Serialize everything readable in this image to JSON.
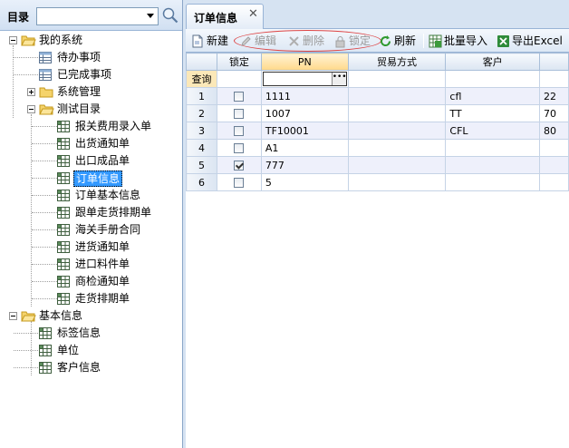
{
  "sidebar": {
    "title": "目录",
    "tree": [
      {
        "label": "我的系统",
        "icon": "folder-open-icon"
      },
      {
        "label": "待办事项",
        "icon": "table-icon"
      },
      {
        "label": "已完成事项",
        "icon": "table-icon"
      },
      {
        "label": "系统管理",
        "icon": "folder-icon"
      },
      {
        "label": "测试目录",
        "icon": "folder-open-icon"
      },
      {
        "label": "报关费用录入单",
        "icon": "form-icon"
      },
      {
        "label": "出货通知单",
        "icon": "form-icon"
      },
      {
        "label": "出口成品单",
        "icon": "form-icon"
      },
      {
        "label": "订单信息",
        "icon": "form-icon",
        "selected": true
      },
      {
        "label": "订单基本信息",
        "icon": "form-icon"
      },
      {
        "label": "跟单走货排期单",
        "icon": "form-icon"
      },
      {
        "label": "海关手册合同",
        "icon": "form-icon"
      },
      {
        "label": "进货通知单",
        "icon": "form-icon"
      },
      {
        "label": "进口料件单",
        "icon": "form-icon"
      },
      {
        "label": "商检通知单",
        "icon": "form-icon"
      },
      {
        "label": "走货排期单",
        "icon": "form-icon"
      },
      {
        "label": "基本信息",
        "icon": "folder-open-icon"
      },
      {
        "label": "标签信息",
        "icon": "form-icon"
      },
      {
        "label": "单位",
        "icon": "form-icon"
      },
      {
        "label": "客户信息",
        "icon": "form-icon"
      }
    ]
  },
  "tab": {
    "title": "订单信息",
    "close": "✕"
  },
  "toolbar": {
    "new": "新建",
    "edit": "编辑",
    "delete": "删除",
    "lock": "锁定",
    "refresh": "刷新",
    "batch_import": "批量导入",
    "export_excel": "导出Excel"
  },
  "grid": {
    "columns": [
      "锁定",
      "PN",
      "贸易方式",
      "客户",
      ""
    ],
    "filter_label": "查询",
    "filter_button": "•••",
    "rows": [
      {
        "num": "1",
        "locked": false,
        "pn": "1111",
        "trade": "",
        "customer": "cfl",
        "extra": "22"
      },
      {
        "num": "2",
        "locked": false,
        "pn": "1007",
        "trade": "",
        "customer": "TT",
        "extra": "70"
      },
      {
        "num": "3",
        "locked": false,
        "pn": "TF10001",
        "trade": "",
        "customer": "CFL",
        "extra": "80"
      },
      {
        "num": "4",
        "locked": false,
        "pn": "A1",
        "trade": "",
        "customer": "",
        "extra": ""
      },
      {
        "num": "5",
        "locked": true,
        "pn": "777",
        "trade": "",
        "customer": "",
        "extra": ""
      },
      {
        "num": "6",
        "locked": false,
        "pn": "5",
        "trade": "",
        "customer": "",
        "extra": ""
      }
    ]
  }
}
